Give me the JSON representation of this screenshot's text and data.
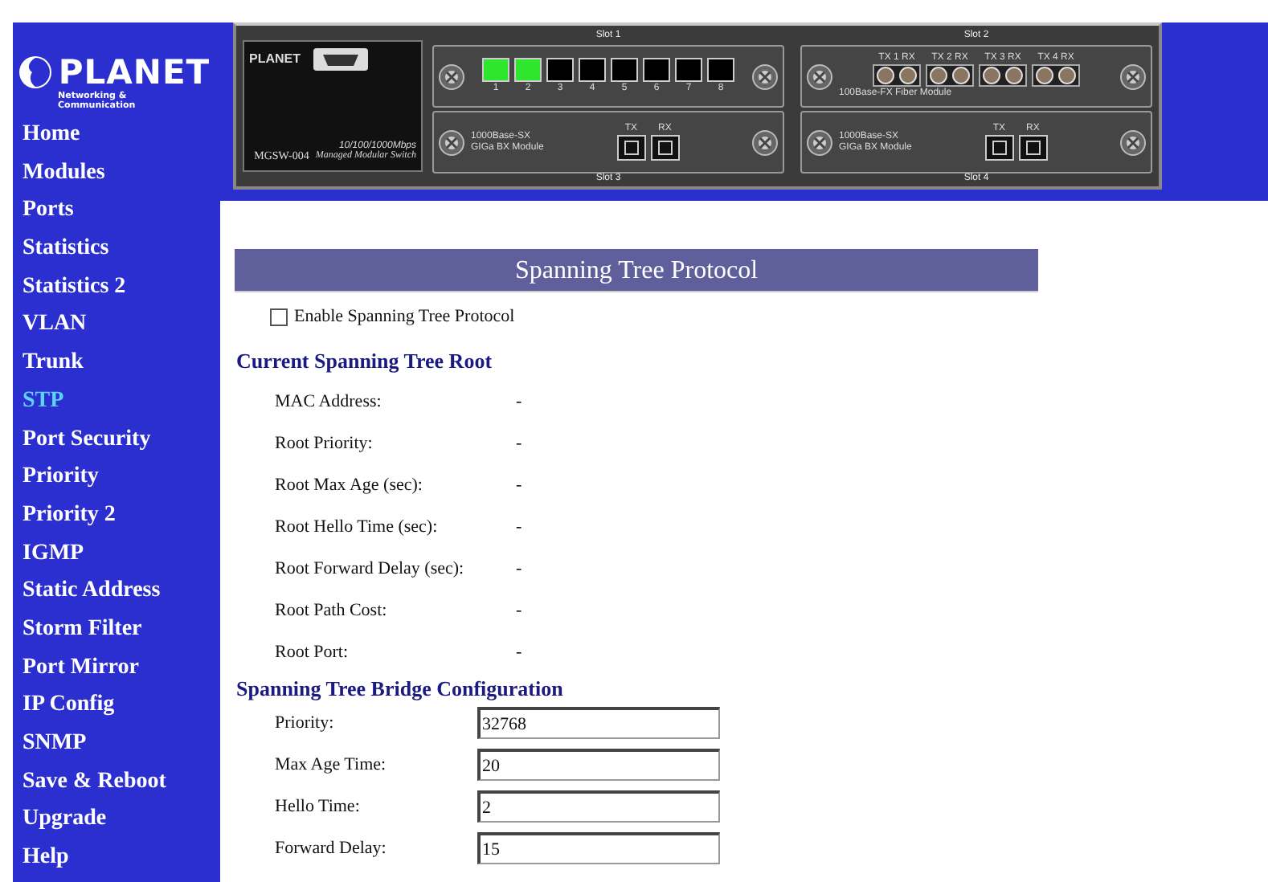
{
  "logo": {
    "name": "PLANET",
    "tagline": "Networking & Communication"
  },
  "device": {
    "brand": "PLANET",
    "speed": "10/100/1000Mbps",
    "model": "MGSW-004",
    "model_desc": "Managed Modular Switch",
    "slots": [
      {
        "label": "Slot 1",
        "kind": "copper",
        "ports": [
          {
            "label": "1",
            "link": true
          },
          {
            "label": "2",
            "link": true
          },
          {
            "label": "3",
            "link": false
          },
          {
            "label": "4",
            "link": false
          },
          {
            "label": "5",
            "link": false
          },
          {
            "label": "6",
            "link": false
          },
          {
            "label": "7",
            "link": false
          },
          {
            "label": "8",
            "link": false
          }
        ]
      },
      {
        "label": "Slot 2",
        "kind": "fiber",
        "module": [
          "100Base-FX Fiber Module"
        ],
        "ports": [
          {
            "label": "TX 1 RX"
          },
          {
            "label": "TX 2 RX"
          },
          {
            "label": "TX 3 RX"
          },
          {
            "label": "TX 4 RX"
          }
        ]
      },
      {
        "label": "Slot 3",
        "kind": "gbic",
        "module": [
          "1000Base-SX",
          "GIGa BX Module"
        ],
        "ports": [
          {
            "label": "TX"
          },
          {
            "label": "RX"
          }
        ]
      },
      {
        "label": "Slot 4",
        "kind": "gbic",
        "module": [
          "1000Base-SX",
          "GIGa BX Module"
        ],
        "ports": [
          {
            "label": "TX"
          },
          {
            "label": "RX"
          }
        ]
      }
    ]
  },
  "sidebar": {
    "items": [
      {
        "label": "Home",
        "selected": false
      },
      {
        "label": "Modules",
        "selected": false
      },
      {
        "label": "Ports",
        "selected": false
      },
      {
        "label": "Statistics",
        "selected": false
      },
      {
        "label": "Statistics 2",
        "selected": false
      },
      {
        "label": "VLAN",
        "selected": false
      },
      {
        "label": "Trunk",
        "selected": false
      },
      {
        "label": "STP",
        "selected": true
      },
      {
        "label": "Port Security",
        "selected": false
      },
      {
        "label": "Priority",
        "selected": false
      },
      {
        "label": "Priority 2",
        "selected": false
      },
      {
        "label": "IGMP",
        "selected": false
      },
      {
        "label": "Static Address",
        "selected": false
      },
      {
        "label": "Storm Filter",
        "selected": false
      },
      {
        "label": "Port Mirror",
        "selected": false
      },
      {
        "label": "IP Config",
        "selected": false
      },
      {
        "label": "SNMP",
        "selected": false
      },
      {
        "label": "Save & Reboot",
        "selected": false
      },
      {
        "label": "Upgrade",
        "selected": false
      },
      {
        "label": "Help",
        "selected": false
      }
    ]
  },
  "page_title": "Spanning Tree Protocol",
  "enable": {
    "label": "Enable Spanning Tree Protocol",
    "checked": false
  },
  "root": {
    "heading": "Current Spanning Tree Root",
    "rows": [
      {
        "label": "MAC Address:",
        "value": "-"
      },
      {
        "label": "Root Priority:",
        "value": "-"
      },
      {
        "label": "Root Max Age (sec):",
        "value": "-"
      },
      {
        "label": "Root Hello Time (sec):",
        "value": "-"
      },
      {
        "label": "Root Forward Delay (sec):",
        "value": "-"
      },
      {
        "label": "Root Path Cost:",
        "value": "-"
      },
      {
        "label": "Root Port:",
        "value": "-"
      }
    ]
  },
  "bridge": {
    "heading": "Spanning Tree Bridge Configuration",
    "fields": [
      {
        "label": "Priority:",
        "value": "32768"
      },
      {
        "label": "Max Age Time:",
        "value": "20"
      },
      {
        "label": "Hello Time:",
        "value": "2"
      },
      {
        "label": "Forward Delay:",
        "value": "15"
      }
    ]
  }
}
